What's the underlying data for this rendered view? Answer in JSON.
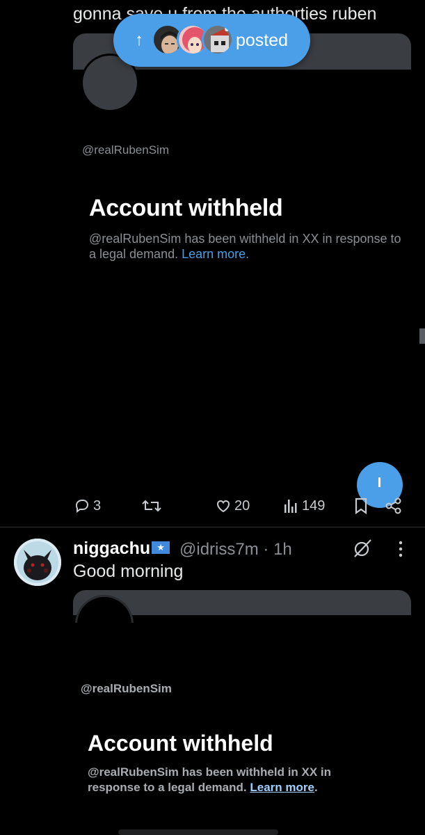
{
  "top_tweet": {
    "text": "gonna save u from the authorties ruben",
    "card": {
      "handle": "@realRubenSim",
      "title": "Account withheld",
      "description": "@realRubenSim has been withheld in XX in response to a legal demand.",
      "link": "Learn more."
    }
  },
  "posted_pill": {
    "label": "posted",
    "arrow": "↑",
    "colors": {
      "background": "#4a9fe8"
    }
  },
  "actions": {
    "reply_count": "3",
    "like_count": "20",
    "view_count": "149"
  },
  "tweet2": {
    "display_name": "niggachu",
    "flag": "★",
    "handle": "@idriss7m",
    "separator": "·",
    "time": "1h",
    "text": "Good morning",
    "card": {
      "handle": "@realRubenSim",
      "title": "Account withheld",
      "description": "@realRubenSim has been withheld in XX in response to a legal demand.",
      "link": "Learn more",
      "trailing": "."
    }
  },
  "colors": {
    "accent": "#4a9fe8",
    "muted_text": "#8b8f94",
    "card_bg": "#3a3d42"
  }
}
